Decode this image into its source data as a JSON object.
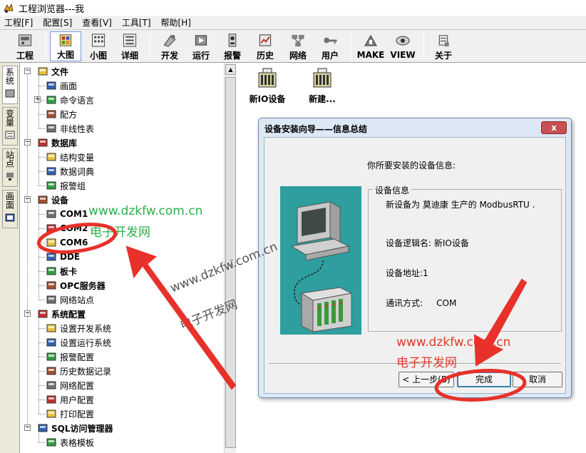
{
  "window": {
    "title": "工程浏览器---我"
  },
  "menu": [
    "工程[F]",
    "配置[S]",
    "查看[V]",
    "工具[T]",
    "帮助[H]"
  ],
  "toolbar": {
    "items": [
      {
        "label": "工程",
        "icon": "project-icon"
      },
      {
        "label": "大图",
        "icon": "large-icons-view-icon",
        "active": true
      },
      {
        "label": "小图",
        "icon": "small-icons-view-icon"
      },
      {
        "label": "详细",
        "icon": "details-view-icon"
      },
      {
        "label": "开发",
        "icon": "develop-icon"
      },
      {
        "label": "运行",
        "icon": "run-icon"
      },
      {
        "label": "报警",
        "icon": "alarm-icon"
      },
      {
        "label": "历史",
        "icon": "history-icon"
      },
      {
        "label": "网络",
        "icon": "network-icon"
      },
      {
        "label": "用户",
        "icon": "user-key-icon"
      },
      {
        "label": "MAKE",
        "icon": "make-icon"
      },
      {
        "label": "VIEW",
        "icon": "view-icon"
      },
      {
        "label": "关于",
        "icon": "about-icon"
      }
    ]
  },
  "side_tabs": [
    "系统",
    "变量",
    "站点",
    "画面"
  ],
  "tree": [
    {
      "label": "文件",
      "level": 0,
      "expander": "−",
      "icon": "folder-icon"
    },
    {
      "label": "画面",
      "level": 1,
      "icon": "screen-icon"
    },
    {
      "label": "命令语言",
      "level": 1,
      "expander": "+",
      "icon": "command-language-icon"
    },
    {
      "label": "配方",
      "level": 1,
      "icon": "recipe-icon"
    },
    {
      "label": "非线性表",
      "level": 1,
      "icon": "nonlinear-table-icon"
    },
    {
      "label": "数据库",
      "level": 0,
      "expander": "−",
      "icon": "database-icon"
    },
    {
      "label": "结构变量",
      "level": 1,
      "icon": "struct-variable-icon"
    },
    {
      "label": "数据词典",
      "level": 1,
      "icon": "data-dictionary-icon"
    },
    {
      "label": "报警组",
      "level": 1,
      "icon": "alarm-group-icon"
    },
    {
      "label": "设备",
      "level": 0,
      "expander": "−",
      "icon": "device-icon"
    },
    {
      "label": "COM1",
      "level": 1,
      "icon": "serial-port-icon",
      "dev": true
    },
    {
      "label": "COM2",
      "level": 1,
      "icon": "serial-port-icon",
      "dev": true
    },
    {
      "label": "COM6",
      "level": 1,
      "icon": "serial-port-icon",
      "dev": true
    },
    {
      "label": "DDE",
      "level": 1,
      "icon": "dde-icon",
      "dev": true
    },
    {
      "label": "板卡",
      "level": 1,
      "icon": "board-card-icon",
      "dev": true
    },
    {
      "label": "OPC服务器",
      "level": 1,
      "icon": "opc-server-icon",
      "dev": true
    },
    {
      "label": "网络站点",
      "level": 1,
      "icon": "network-station-icon"
    },
    {
      "label": "系统配置",
      "level": 0,
      "expander": "−",
      "icon": "system-config-icon"
    },
    {
      "label": "设置开发系统",
      "level": 1,
      "icon": "dev-system-icon"
    },
    {
      "label": "设置运行系统",
      "level": 1,
      "icon": "run-system-icon"
    },
    {
      "label": "报警配置",
      "level": 1,
      "icon": "alarm-config-icon"
    },
    {
      "label": "历史数据记录",
      "level": 1,
      "icon": "history-record-icon"
    },
    {
      "label": "网络配置",
      "level": 1,
      "icon": "network-config-icon"
    },
    {
      "label": "用户配置",
      "level": 1,
      "icon": "user-config-icon"
    },
    {
      "label": "打印配置",
      "level": 1,
      "icon": "print-config-icon"
    },
    {
      "label": "SQL访问管理器",
      "level": 0,
      "expander": "−",
      "icon": "sql-manager-icon"
    },
    {
      "label": "表格模板",
      "level": 1,
      "icon": "table-template-icon"
    }
  ],
  "right_icons": [
    {
      "label": "新IO设备",
      "icon": "io-device-icon"
    },
    {
      "label": "新建...",
      "icon": "new-device-icon"
    }
  ],
  "dialog": {
    "title": "设备安装向导——信息总结",
    "close_label": "x",
    "heading": "你所要安装的设备信息:",
    "group_title": "设备信息",
    "line1": "新设备为 莫迪康 生产的 ModbusRTU .",
    "line2": "设备逻辑名: 新IO设备",
    "line3": "设备地址:1",
    "line4": "通讯方式:     COM",
    "back_label": "< 上一步(B)",
    "finish_label": "完成",
    "cancel_label": "取消"
  },
  "watermarks": {
    "url": "www.dzkfw.com.cn",
    "name": "电子开发网"
  },
  "colors": {
    "annotation_red": "#e8312a",
    "watermark_green": "#2bb04a",
    "watermark_red": "#e23b2b"
  }
}
